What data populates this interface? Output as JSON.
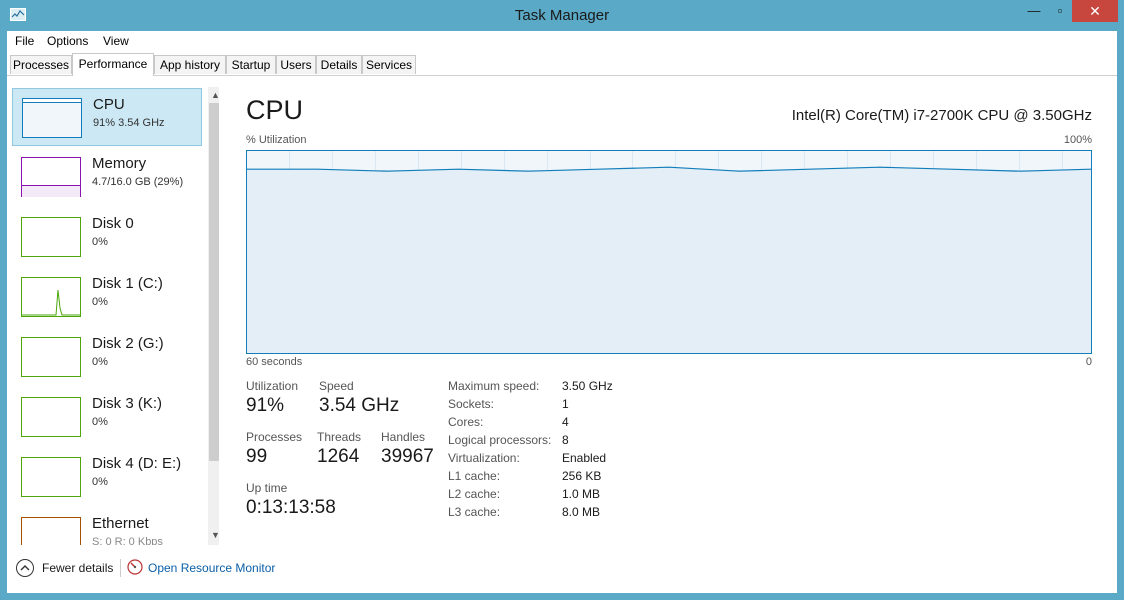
{
  "window": {
    "title": "Task Manager",
    "minimize": "—",
    "maximize": "▫",
    "close": "✕"
  },
  "menu": {
    "file": "File",
    "options": "Options",
    "view": "View"
  },
  "tabs": [
    "Processes",
    "Performance",
    "App history",
    "Startup",
    "Users",
    "Details",
    "Services"
  ],
  "sidebar": {
    "items": [
      {
        "name": "CPU",
        "value": "91%  3.54 GHz",
        "color": "#117dbb"
      },
      {
        "name": "Memory",
        "value": "4.7/16.0 GB (29%)",
        "color": "#8b12ae"
      },
      {
        "name": "Disk 0",
        "value": "0%",
        "color": "#4da60c"
      },
      {
        "name": "Disk 1 (C:)",
        "value": "0%",
        "color": "#4da60c"
      },
      {
        "name": "Disk 2 (G:)",
        "value": "0%",
        "color": "#4da60c"
      },
      {
        "name": "Disk 3 (K:)",
        "value": "0%",
        "color": "#4da60c"
      },
      {
        "name": "Disk 4 (D: E:)",
        "value": "0%",
        "color": "#4da60c"
      },
      {
        "name": "Ethernet",
        "value": "S: 0 R: 0 Kbps",
        "color": "#a74f01"
      }
    ]
  },
  "main": {
    "title": "CPU",
    "model": "Intel(R) Core(TM) i7-2700K CPU @ 3.50GHz",
    "util_label": "% Utilization",
    "util_max": "100%",
    "time_label": "60 seconds",
    "zero_label": "0",
    "chart_data": {
      "type": "line",
      "x": [
        60,
        55,
        50,
        45,
        40,
        35,
        30,
        25,
        20,
        15,
        10,
        5,
        0
      ],
      "values": [
        91,
        91,
        90,
        91,
        90,
        91,
        92,
        90,
        91,
        92,
        91,
        90,
        91
      ],
      "ylim": [
        0,
        100
      ],
      "grid": true,
      "color": "#117dbb"
    },
    "stats": {
      "utilization_label": "Utilization",
      "utilization": "91%",
      "speed_label": "Speed",
      "speed": "3.54 GHz",
      "processes_label": "Processes",
      "processes": "99",
      "threads_label": "Threads",
      "threads": "1264",
      "handles_label": "Handles",
      "handles": "39967",
      "uptime_label": "Up time",
      "uptime": "0:13:13:58"
    },
    "details": [
      {
        "label": "Maximum speed:",
        "value": "3.50 GHz"
      },
      {
        "label": "Sockets:",
        "value": "1"
      },
      {
        "label": "Cores:",
        "value": "4"
      },
      {
        "label": "Logical processors:",
        "value": "8"
      },
      {
        "label": "Virtualization:",
        "value": "Enabled"
      },
      {
        "label": "L1 cache:",
        "value": "256 KB"
      },
      {
        "label": "L2 cache:",
        "value": "1.0 MB"
      },
      {
        "label": "L3 cache:",
        "value": "8.0 MB"
      }
    ]
  },
  "footer": {
    "fewer_details": "Fewer details",
    "open_resource_monitor": "Open Resource Monitor"
  },
  "icons": {
    "app": "task-manager-icon",
    "collapse": "chevron-up-icon",
    "resource_monitor": "resource-monitor-icon",
    "scroll_up": "scroll-up-arrow-icon",
    "scroll_down": "scroll-down-arrow-icon"
  }
}
